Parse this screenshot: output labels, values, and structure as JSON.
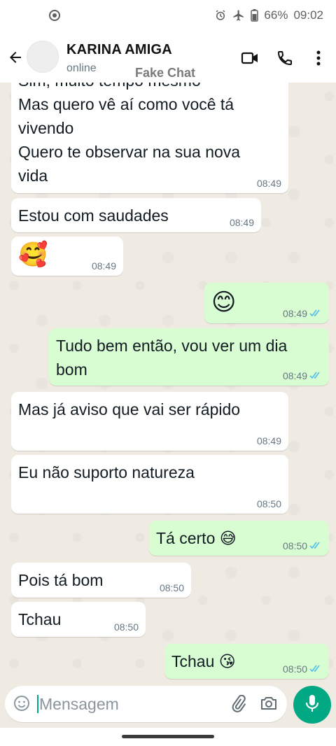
{
  "status_bar": {
    "battery": "66%",
    "time": "09:02"
  },
  "header": {
    "contact_name": "KARINA AMIGA",
    "status": "online",
    "watermark": "Fake Chat"
  },
  "messages": [
    {
      "dir": "in",
      "text": "Sim, muito tempo mesmo\nMas quero vê aí como você tá\nvivendo\nQuero te observar na sua nova\nvida",
      "time": "08:49"
    },
    {
      "dir": "in",
      "text": "Estou com saudades",
      "time": "08:49"
    },
    {
      "dir": "in",
      "text": "🥰",
      "time": "08:49"
    },
    {
      "dir": "out",
      "text": "😊",
      "time": "08:49"
    },
    {
      "dir": "out",
      "text": "Tudo bem então, vou ver um dia\nbom",
      "time": "08:49"
    },
    {
      "dir": "in",
      "text": "Mas já aviso que vai ser rápido",
      "time": "08:49"
    },
    {
      "dir": "in",
      "text": "Eu não suporto natureza",
      "time": "08:50"
    },
    {
      "dir": "out",
      "text": "Tá certo 😅",
      "time": "08:50"
    },
    {
      "dir": "in",
      "text": "Pois tá bom",
      "time": "08:50"
    },
    {
      "dir": "in",
      "text": "Tchau",
      "time": "08:50"
    },
    {
      "dir": "out",
      "text": "Tchau 😘",
      "time": "08:50"
    }
  ],
  "input": {
    "placeholder": "Mensagem"
  },
  "colors": {
    "accent": "#00a884",
    "outgoing_bubble": "#d9fdd3",
    "incoming_bubble": "#ffffff",
    "chat_background": "#efeae2",
    "read_ticks": "#53bdeb"
  },
  "icons": [
    "back-arrow-icon",
    "video-call-icon",
    "phone-icon",
    "more-vert-icon",
    "emoji-icon",
    "attach-icon",
    "camera-icon",
    "mic-icon",
    "double-check-icon",
    "alarm-icon",
    "airplane-icon",
    "battery-icon"
  ]
}
